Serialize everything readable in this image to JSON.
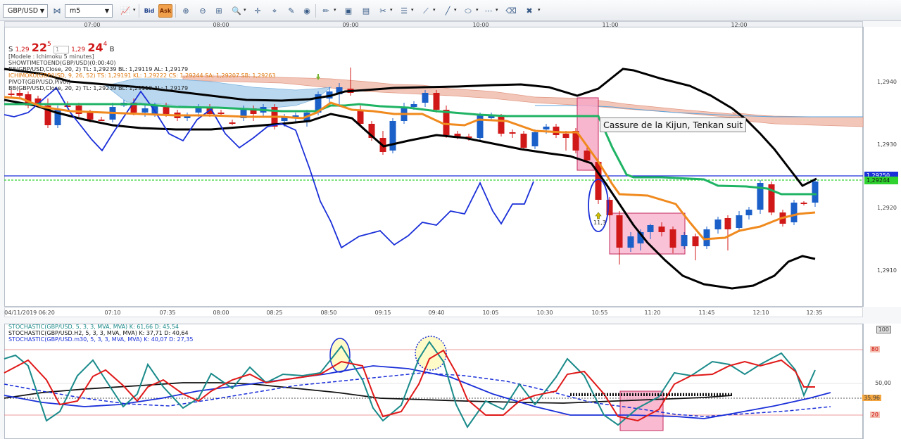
{
  "toolbar": {
    "symbol": "GBP/USD",
    "timeframe": "m5",
    "bid_label": "Bid",
    "ask_label": "Ask",
    "icons": [
      "chart-type-icon",
      "zoom-in-icon",
      "zoom-out-icon",
      "magnifier-icon",
      "crosshair-icon",
      "cursor-icon",
      "compass-icon",
      "globe-icon",
      "pencil-icon",
      "image-icon",
      "save-icon",
      "tools-icon",
      "lines-icon",
      "draw-icon",
      "line-icon",
      "dots-icon",
      "shape-icon",
      "fib-icon",
      "eraser-icon",
      "delete-icon"
    ]
  },
  "top_time_labels": [
    "07:00",
    "08:00",
    "09:00",
    "10:00",
    "11:00",
    "12:00"
  ],
  "bottom_time_labels": [
    "04/11/2019 06:20",
    "07:10",
    "07:35",
    "08:00",
    "08:25",
    "08:50",
    "09:15",
    "09:40",
    "10:05",
    "10:30",
    "10:55",
    "11:20",
    "11:45",
    "12:10",
    "12:35"
  ],
  "quote": {
    "sell_letter": "S",
    "sell_prefix": "1,29",
    "sell_big": "22",
    "sell_sup": "5",
    "spread": "1",
    "buy_prefix": "1,29",
    "buy_big": "24",
    "buy_sup": "4",
    "buy_letter": "B"
  },
  "info_lines": [
    {
      "text": "[Modele : Ichimoku 5 minutes]",
      "color": "#444"
    },
    {
      "text": "SHOWTIMETOEND(GBP/USD)(0:00:40)",
      "color": "#333"
    },
    {
      "text": "BB(GBP/USD,Close, 20, 2)  TL: 1,29239  BL: 1,29119  AL: 1,29179",
      "color": "#222"
    },
    {
      "text": "ICHIMOKU(GBP/USD, 9, 26, 52)  TS: 1,29191  KL: 1,29222  CS: 1,29244  SA: 1,29207  SB: 1,29263",
      "color": "#e07a10"
    },
    {
      "text": "PIVOT(GBP/USD,Pivot)",
      "color": "#333"
    },
    {
      "text": "BB(GBP/USD,Close, 20, 2)  TL: 1,29239  BL: 1,29119  AL: 1,29179",
      "color": "#222"
    }
  ],
  "price_axis": [
    "1,2940",
    "1,2930",
    "1,2920",
    "1,2910"
  ],
  "price_tags": {
    "blue_line": "1,29250",
    "green_line": "1,29244"
  },
  "annotation": "Cassure de la Kijun, Tenkan suit",
  "circle_label": "11,3",
  "stoch_lines": [
    {
      "text": "STOCHASTIC(GBP/USD, 5, 3, 3, MVA, MVA)  K: 61,66  D: 45,54",
      "color": "#1a8a8a"
    },
    {
      "text": "STOCHASTIC(GBP/USD.H2, 5, 3, 3, MVA, MVA)  K: 37,71  D: 40,64",
      "color": "#111"
    },
    {
      "text": "STOCHASTIC(GBP/USD.m30, 5, 3, 3, MVA, MVA)  K: 40,07  D: 27,35",
      "color": "#1a2fd8"
    }
  ],
  "stoch_axis": {
    "top": "100",
    "upper": "80",
    "mid": "50,00",
    "value": "35,96",
    "lower": "20"
  },
  "colors": {
    "bull": "#1b5fc9",
    "bear": "#d01818",
    "kijun": "#1fb364",
    "tenkan": "#f08a1e",
    "bb": "#000000",
    "pivot_blue": "#1a2fd8",
    "cloud_up": "#b9d7ee",
    "cloud_down": "#f2c6b8",
    "highlight": "#f7a8c6"
  }
}
